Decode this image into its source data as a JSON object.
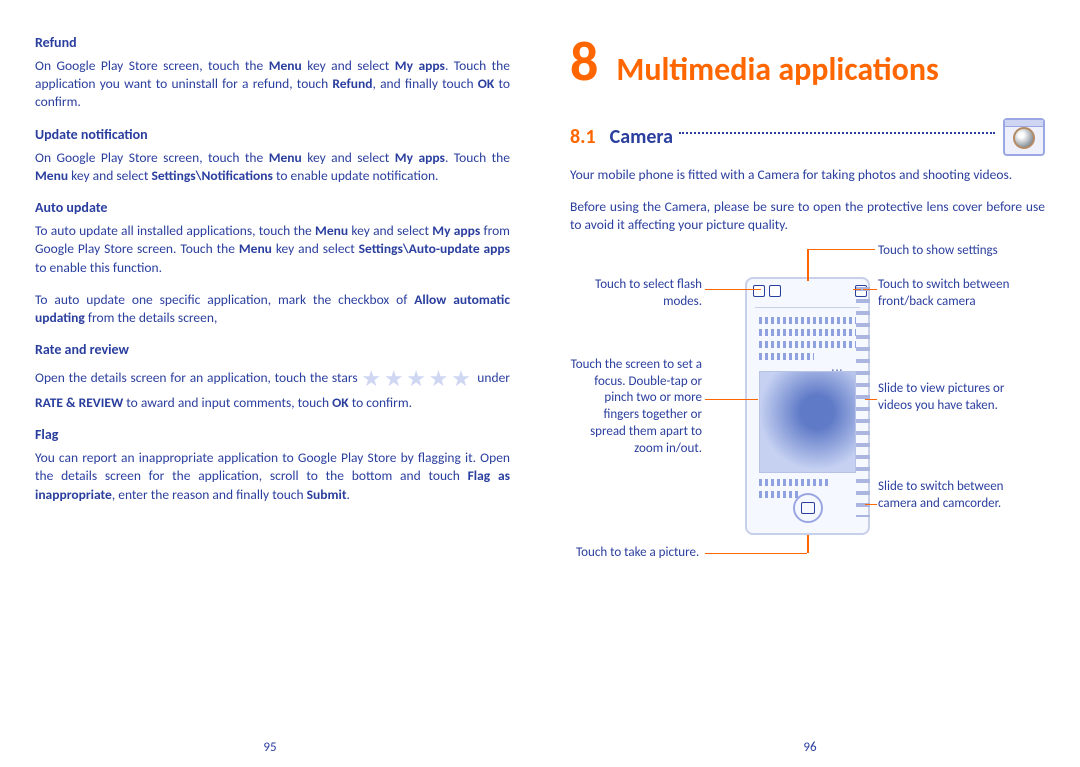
{
  "left": {
    "refund_h": "Refund",
    "refund_p": "On Google Play Store screen, touch the Menu key and select My apps. Touch the application you want to uninstall for a refund, touch Refund, and finally touch OK to confirm.",
    "update_h": "Update notification",
    "update_p": "On Google Play Store screen, touch the Menu key and select My apps. Touch the Menu key and select Settings\\Notifications to enable update notification.",
    "auto_h": "Auto update",
    "auto_p1": "To auto update all installed applications, touch the Menu key and select My apps from Google Play Store screen. Touch the Menu key and select Settings\\Auto-update apps to enable this function.",
    "auto_p2": "To auto update one specific application, mark the checkbox of Allow automatic updating from the details screen,",
    "rate_h": "Rate and review",
    "rate_p1a": "Open the details screen for an application, touch the stars ",
    "rate_p1b": " under RATE & REVIEW to award  and input comments, touch OK to confirm.",
    "flag_h": "Flag",
    "flag_p": "You can report an inappropriate application to Google Play Store by flagging it. Open the details screen for the application, scroll to the bottom and touch Flag as inappropriate, enter the reason and finally touch Submit.",
    "page_num": "95"
  },
  "right": {
    "chapter_num": "8",
    "chapter_title": "Multimedia applications",
    "section_num": "8.1",
    "section_title": "Camera",
    "p1": "Your mobile phone is fitted with a Camera for taking photos and shooting videos.",
    "p2": "Before using the Camera, please be sure to open the protective lens cover before use to avoid it affecting your picture quality.",
    "labels": {
      "settings": "Touch to show settings",
      "flash": "Touch to select flash modes.",
      "switch_cam": "Touch to switch between front/back camera",
      "focus": "Touch the screen to set a focus. Double-tap or pinch two or more fingers together or spread them apart to zoom in/out.",
      "view": "Slide to view pictures or videos you have taken.",
      "slide_mode": "Slide to switch between camera and camcorder.",
      "take": "Touch to take a picture."
    },
    "page_num": "96"
  }
}
